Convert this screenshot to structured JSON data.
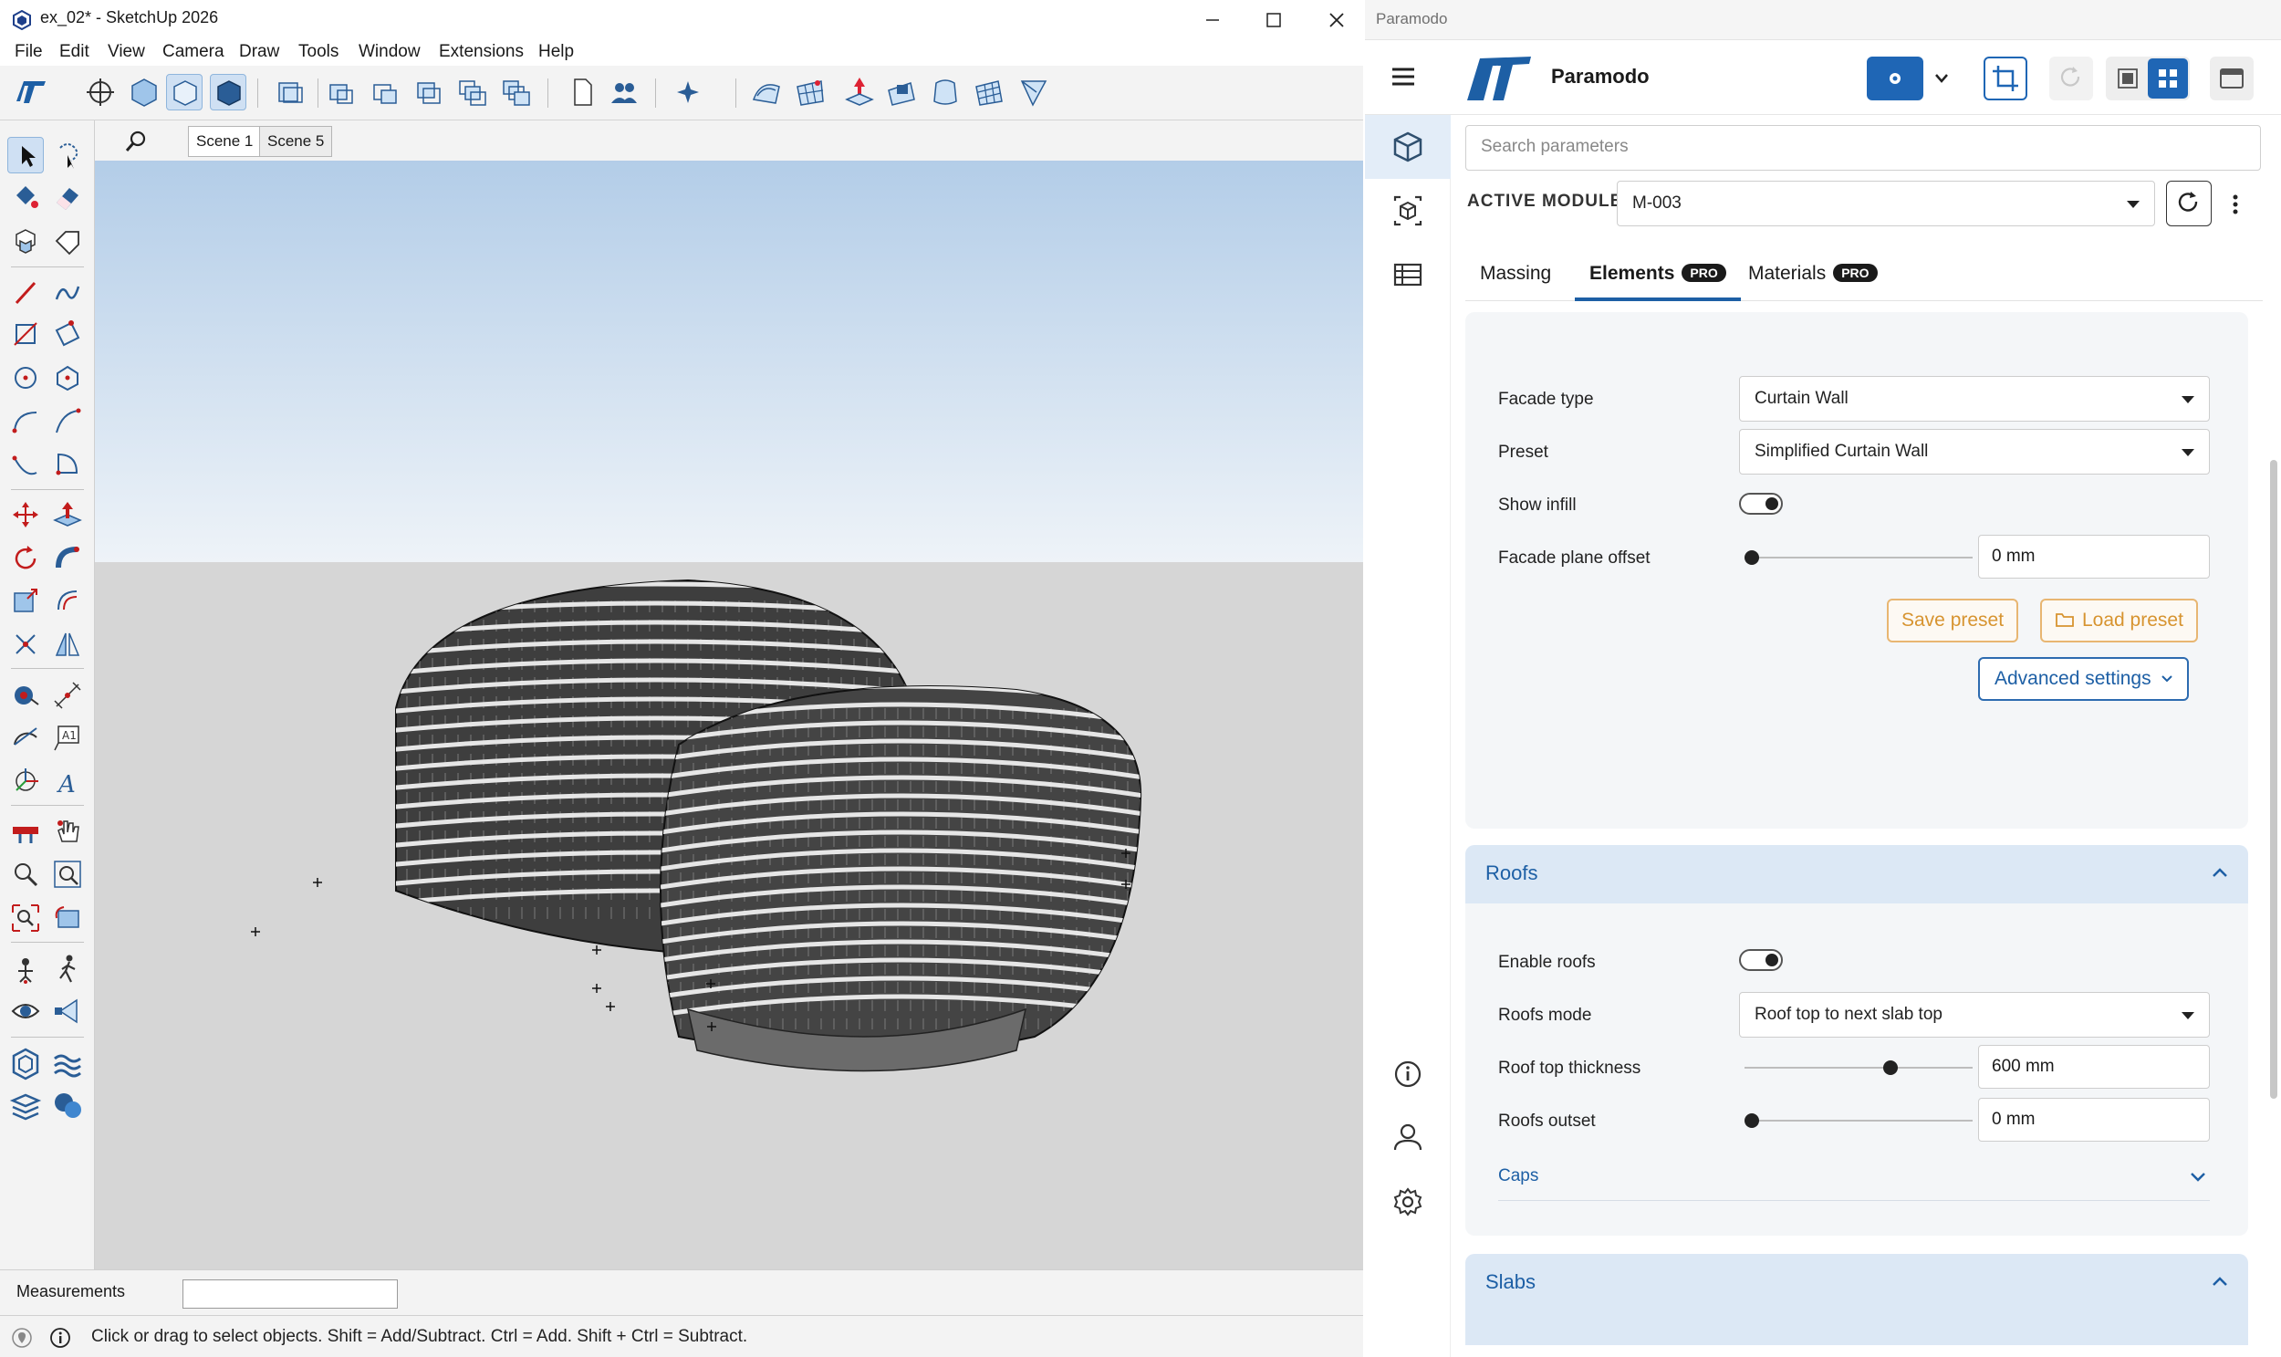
{
  "sketchup": {
    "title": "ex_02* - SketchUp 2026",
    "menu": [
      "File",
      "Edit",
      "View",
      "Camera",
      "Draw",
      "Tools",
      "Window",
      "Extensions",
      "Help"
    ],
    "scenes": [
      "Scene 1",
      "Scene 5"
    ],
    "measurements_label": "Measurements",
    "measurements_value": "",
    "status_text": "Click or drag to select objects. Shift = Add/Subtract. Ctrl = Add. Shift + Ctrl = Subtract."
  },
  "paramodo": {
    "window_title": "Paramodo",
    "brand": "Paramodo",
    "search_placeholder": "Search parameters",
    "active_module_label": "ACTIVE MODULE:",
    "active_module_value": "M-003",
    "tabs": [
      {
        "label": "Massing",
        "pro": false
      },
      {
        "label": "Elements",
        "pro": true,
        "active": true
      },
      {
        "label": "Materials",
        "pro": true
      }
    ],
    "pro_badge": "PRO",
    "facade": {
      "facade_type_label": "Facade type",
      "facade_type_value": "Curtain Wall",
      "preset_label": "Preset",
      "preset_value": "Simplified Curtain Wall",
      "show_infill_label": "Show infill",
      "show_infill": true,
      "plane_offset_label": "Facade plane offset",
      "plane_offset_value": "0 mm",
      "plane_offset_fraction": 0.0,
      "save_preset": "Save preset",
      "load_preset": "Load preset",
      "advanced_settings": "Advanced settings"
    },
    "roofs": {
      "title": "Roofs",
      "enable_label": "Enable roofs",
      "enable": true,
      "mode_label": "Roofs mode",
      "mode_value": "Roof top to next slab top",
      "thickness_label": "Roof top thickness",
      "thickness_value": "600 mm",
      "thickness_fraction": 0.65,
      "outset_label": "Roofs outset",
      "outset_value": "0 mm",
      "outset_fraction": 0.0,
      "caps_label": "Caps"
    },
    "slabs": {
      "title": "Slabs"
    }
  },
  "colors": {
    "accent_blue": "#1d5fa5",
    "primary_button": "#1f66b5",
    "orange": "#d79430",
    "section_header": "#dce8f5",
    "sky_top": "#b8d0e8",
    "ground": "#d9d9d9"
  }
}
